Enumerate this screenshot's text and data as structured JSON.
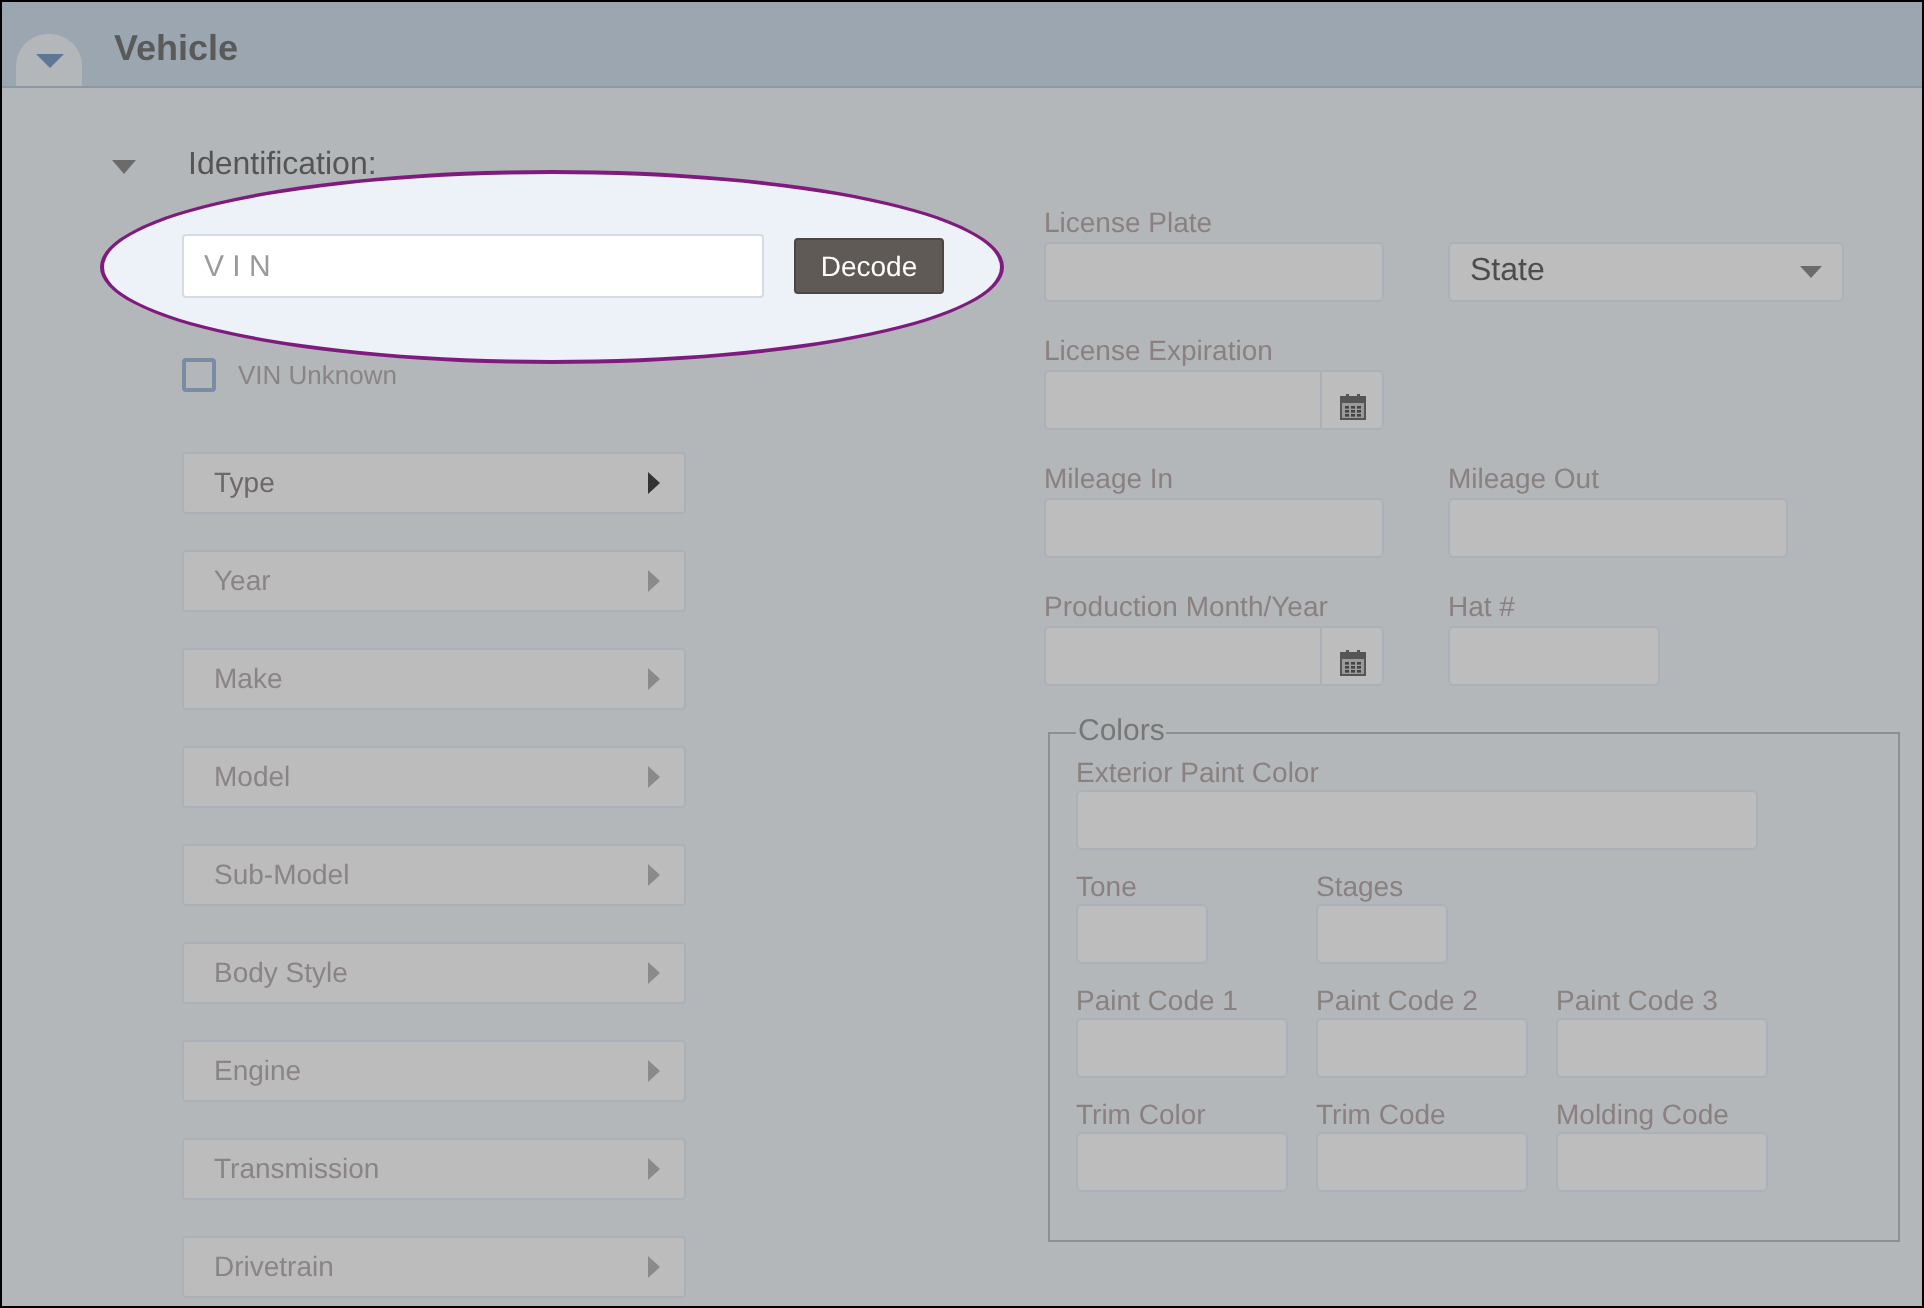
{
  "header": {
    "title": "Vehicle",
    "expanded": true
  },
  "section": {
    "title": "Identification:",
    "expanded": true
  },
  "vin": {
    "placeholder": "V I N",
    "button": "Decode"
  },
  "vin_unknown": {
    "label": "VIN Unknown",
    "checked": false
  },
  "selectors": [
    {
      "label": "Type",
      "disabled": false
    },
    {
      "label": "Year",
      "disabled": true
    },
    {
      "label": "Make",
      "disabled": true
    },
    {
      "label": "Model",
      "disabled": true
    },
    {
      "label": "Sub-Model",
      "disabled": true
    },
    {
      "label": "Body Style",
      "disabled": true
    },
    {
      "label": "Engine",
      "disabled": true
    },
    {
      "label": "Transmission",
      "disabled": true
    },
    {
      "label": "Drivetrain",
      "disabled": true
    }
  ],
  "field_rows": [
    [
      {
        "label": "License Plate",
        "kind": "text"
      },
      {
        "kind": "select",
        "value": "State"
      }
    ],
    [
      {
        "label": "License Expiration",
        "kind": "date"
      }
    ],
    [
      {
        "label": "Mileage In",
        "kind": "text"
      },
      {
        "label": "Mileage Out",
        "kind": "text"
      }
    ],
    [
      {
        "label": "Production Month/Year",
        "kind": "date"
      },
      {
        "label": "Hat #",
        "kind": "short"
      }
    ]
  ],
  "colors": {
    "title": "Colors",
    "rows": [
      [
        {
          "label": "Exterior Paint Color",
          "kind": "wide"
        }
      ],
      [
        {
          "label": "Tone",
          "kind": "tiny"
        },
        {
          "label": "Stages",
          "kind": "tiny"
        }
      ],
      [
        {
          "label": "Paint Code 1",
          "kind": "text"
        },
        {
          "label": "Paint Code 2",
          "kind": "text"
        },
        {
          "label": "Paint Code 3",
          "kind": "text"
        }
      ],
      [
        {
          "label": "Trim Color",
          "kind": "text"
        },
        {
          "label": "Trim Code",
          "kind": "text"
        },
        {
          "label": "Molding Code",
          "kind": "text"
        }
      ]
    ]
  }
}
